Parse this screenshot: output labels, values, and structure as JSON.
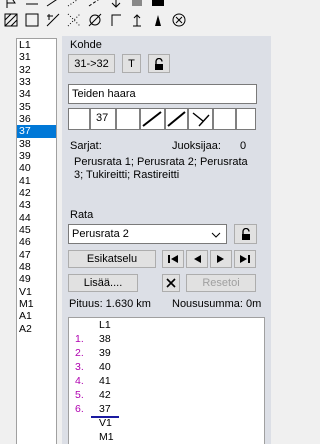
{
  "toolbar": {
    "row1": [
      "flag-icon",
      "finish-line-icon",
      "line-icon",
      "dotted-line-icon",
      "dashed-line-icon",
      "arrow-icon",
      "fill-icon",
      "black-rect-icon",
      "blank-icon"
    ],
    "row2": [
      "hatched-square-icon",
      "square-icon",
      "crossing-icon",
      "dotted-cross-icon",
      "circle-slash-icon",
      "corner-icon",
      "up-arrow-icon",
      "bridge-icon",
      "circle-x-icon"
    ]
  },
  "controls": {
    "items": [
      "L1",
      "31",
      "32",
      "33",
      "34",
      "35",
      "36",
      "37",
      "38",
      "39",
      "40",
      "41",
      "42",
      "43",
      "44",
      "45",
      "46",
      "47",
      "48",
      "49",
      "V1",
      "M1",
      "A1",
      "A2"
    ],
    "selected": "37"
  },
  "kohde": {
    "title": "Kohde",
    "code_button": "31->32",
    "t_button": "T",
    "name_value": "Teiden haara",
    "symbol_code": "37"
  },
  "usage": {
    "sarjat_label": "Sarjat:",
    "juoksijaa_label": "Juoksijaa:",
    "juoksijaa_value": "0",
    "courses_text": "Perusrata 1; Perusrata 2; Perusrata 3; Tukireitti; Rastireitti"
  },
  "rata": {
    "title": "Rata",
    "selected_course": "Perusrata 2",
    "preview_button": "Esikatselu",
    "add_button": "Lisää....",
    "reset_button": "Resetoi",
    "length_text": "Pituus: 1.630 km",
    "climb_text": "Noususumma: 0m"
  },
  "course_legs": [
    {
      "num": "",
      "code": "L1"
    },
    {
      "num": "1.",
      "code": "38"
    },
    {
      "num": "2.",
      "code": "39"
    },
    {
      "num": "3.",
      "code": "40"
    },
    {
      "num": "4.",
      "code": "41"
    },
    {
      "num": "5.",
      "code": "42"
    },
    {
      "num": "6.",
      "code": "37"
    },
    {
      "num": "",
      "code": "V1"
    },
    {
      "num": "",
      "code": "M1"
    }
  ],
  "colors": {
    "selection": "#0078d7",
    "leg_number": "#b000b0",
    "panel_bg": "#dcdfe6"
  }
}
